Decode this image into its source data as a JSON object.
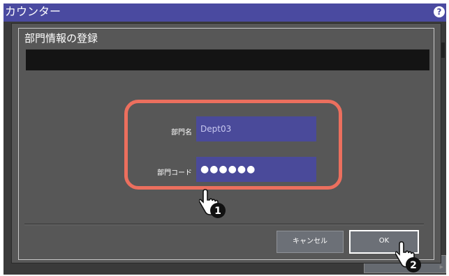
{
  "app": {
    "title": "カウンター",
    "help_icon": "question-icon"
  },
  "dialog": {
    "title": "部門情報の登録",
    "fields": [
      {
        "label": "部門名",
        "value": "Dept03"
      },
      {
        "label": "部門コード",
        "value": "●●●●●●"
      }
    ],
    "buttons": {
      "cancel": "キャンセル",
      "ok": "OK"
    }
  },
  "annotations": {
    "step1": "1",
    "step2": "2",
    "highlight_color": "#ec6f5e"
  }
}
